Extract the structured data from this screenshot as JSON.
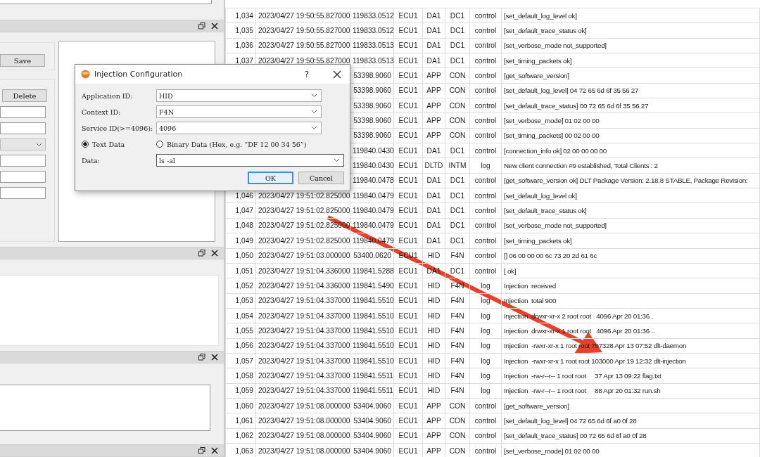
{
  "left_panel": {
    "save_button": "Save",
    "delete_button": "Delete"
  },
  "dialog": {
    "title": "Injection Configuration",
    "help_button": "?",
    "fields": [
      {
        "label": "Application ID:",
        "value": "HID"
      },
      {
        "label": "Context ID:",
        "value": "F4N"
      },
      {
        "label": "Service ID(>=4096):",
        "value": "4096"
      }
    ],
    "radios": [
      {
        "label": "Text Data",
        "selected": true
      },
      {
        "label": "Binary Data (Hex, e.g. “DF 12 00 34 56”)",
        "selected": false
      }
    ],
    "data": {
      "label": "Data:",
      "value": "ls -al"
    },
    "buttons": [
      {
        "label": "OK",
        "default": true
      },
      {
        "label": "Cancel",
        "default": false
      }
    ]
  },
  "log_table": {
    "rows": [
      {
        "index": "1,034",
        "time": "2023/04/27 19:50:55.827000",
        "timestamp": "119833.0512",
        "ecu": "ECU1",
        "apid": "DA1",
        "ctid": "DC1",
        "type": "control",
        "payload": "[set_default_log_level ok]"
      },
      {
        "index": "1,035",
        "time": "2023/04/27 19:50:55.827000",
        "timestamp": "119833.0512",
        "ecu": "ECU1",
        "apid": "DA1",
        "ctid": "DC1",
        "type": "control",
        "payload": "[set_default_trace_status ok]"
      },
      {
        "index": "1,036",
        "time": "2023/04/27 19:50:55.827000",
        "timestamp": "119833.0513",
        "ecu": "ECU1",
        "apid": "DA1",
        "ctid": "DC1",
        "type": "control",
        "payload": "[set_verbose_mode not_supported]"
      },
      {
        "index": "1,037",
        "time": "2023/04/27 19:50:55.827000",
        "timestamp": "119833.0513",
        "ecu": "ECU1",
        "apid": "DA1",
        "ctid": "DC1",
        "type": "control",
        "payload": "[set_timing_packets ok]"
      },
      {
        "timestamp": "53398.9060",
        "ecu": "ECU1",
        "apid": "APP",
        "ctid": "CON",
        "type": "control",
        "payload": "[get_software_version]"
      },
      {
        "timestamp": "53398.9060",
        "ecu": "ECU1",
        "apid": "APP",
        "ctid": "CON",
        "type": "control",
        "payload": "[set_default_log_level] 04 72 65 6d 6f 35 56 27"
      },
      {
        "timestamp": "53398.9060",
        "ecu": "ECU1",
        "apid": "APP",
        "ctid": "CON",
        "type": "control",
        "payload": "[set_default_trace_status] 00 72 65 6d 6f 35 56 27"
      },
      {
        "timestamp": "53398.9060",
        "ecu": "ECU1",
        "apid": "APP",
        "ctid": "CON",
        "type": "control",
        "payload": "[set_verbose_mode] 01 02 00 00"
      },
      {
        "timestamp": "53398.9060",
        "ecu": "ECU1",
        "apid": "APP",
        "ctid": "CON",
        "type": "control",
        "payload": "[set_timing_packets] 00 02 00 00"
      },
      {
        "timestamp": "119840.0430",
        "ecu": "ECU1",
        "apid": "DA1",
        "ctid": "DC1",
        "type": "control",
        "payload": "[connection_info ok] 02 00 00 00 00"
      },
      {
        "timestamp": "119840.0430",
        "ecu": "ECU1",
        "apid": "DLTD",
        "ctid": "INTM",
        "type": "log",
        "payload": "New client connection #9 established, Total Clients : 2"
      },
      {
        "timestamp": "119840.0478",
        "ecu": "ECU1",
        "apid": "DA1",
        "ctid": "DC1",
        "type": "control",
        "payload": "[get_software_version ok] DLT Package Version: 2.18.8 STABLE, Package Revision:"
      },
      {
        "index": "1,046",
        "time": "2023/04/27 19:51:02.825000",
        "timestamp": "119840.0479",
        "ecu": "ECU1",
        "apid": "DA1",
        "ctid": "DC1",
        "type": "control",
        "payload": "[set_default_log_level ok]"
      },
      {
        "index": "1,047",
        "time": "2023/04/27 19:51:02.825000",
        "timestamp": "119840.0479",
        "ecu": "ECU1",
        "apid": "DA1",
        "ctid": "DC1",
        "type": "control",
        "payload": "[set_default_trace_status ok]"
      },
      {
        "index": "1,048",
        "time": "2023/04/27 19:51:02.825000",
        "timestamp": "119840.0479",
        "ecu": "ECU1",
        "apid": "DA1",
        "ctid": "DC1",
        "type": "control",
        "payload": "[set_verbose_mode not_supported]"
      },
      {
        "index": "1,049",
        "time": "2023/04/27 19:51:02.825000",
        "timestamp": "119840.0479",
        "ecu": "ECU1",
        "apid": "DA1",
        "ctid": "DC1",
        "type": "control",
        "payload": "[set_timing_packets ok]"
      },
      {
        "index": "1,050",
        "time": "2023/04/27 19:51:03.000000",
        "timestamp": "53400.0620",
        "ecu": "ECU1",
        "apid": "HID",
        "ctid": "F4N",
        "type": "control",
        "payload": "[] 06 00 00 00 6c 73 20 2d 61 6c"
      },
      {
        "index": "1,051",
        "time": "2023/04/27 19:51:04.336000",
        "timestamp": "119841.5288",
        "ecu": "ECU1",
        "apid": "DA1",
        "ctid": "DC1",
        "type": "control",
        "payload": "[ ok]"
      },
      {
        "index": "1,052",
        "time": "2023/04/27 19:51:04.336000",
        "timestamp": "119841.5490",
        "ecu": "ECU1",
        "apid": "HID",
        "ctid": "F4N",
        "type": "log",
        "payload": "Injection  received"
      },
      {
        "index": "1,053",
        "time": "2023/04/27 19:51:04.337000",
        "timestamp": "119841.5510",
        "ecu": "ECU1",
        "apid": "HID",
        "ctid": "F4N",
        "type": "log",
        "payload": "Injection  total 900"
      },
      {
        "index": "1,054",
        "time": "2023/04/27 19:51:04.337000",
        "timestamp": "119841.5510",
        "ecu": "ECU1",
        "apid": "HID",
        "ctid": "F4N",
        "type": "log",
        "payload": "Injection  drwxr-xr-x 2 root root   4096 Apr 20 01:36 ."
      },
      {
        "index": "1,055",
        "time": "2023/04/27 19:51:04.337000",
        "timestamp": "119841.5510",
        "ecu": "ECU1",
        "apid": "HID",
        "ctid": "F4N",
        "type": "log",
        "payload": "Injection  drwxr-xr-x 1 root root   4096 Apr 20 01:36 .."
      },
      {
        "index": "1,056",
        "time": "2023/04/27 19:51:04.337000",
        "timestamp": "119841.5510",
        "ecu": "ECU1",
        "apid": "HID",
        "ctid": "F4N",
        "type": "log",
        "payload": "Injection  -rwxr-xr-x 1 root root 797328 Apr 13 07:52 dlt-daemon"
      },
      {
        "index": "1,057",
        "time": "2023/04/27 19:51:04.337000",
        "timestamp": "119841.5510",
        "ecu": "ECU1",
        "apid": "HID",
        "ctid": "F4N",
        "type": "log",
        "payload": "Injection  -rwxr-xr-x 1 root root 103000 Apr 19 12:32 dlt-injection"
      },
      {
        "index": "1,058",
        "time": "2023/04/27 19:51:04.337000",
        "timestamp": "119841.5511",
        "ecu": "ECU1",
        "apid": "HID",
        "ctid": "F4N",
        "type": "log",
        "payload": "Injection  -rw-r--r-- 1 root root     37 Apr 13 09:22 flag.txt"
      },
      {
        "index": "1,059",
        "time": "2023/04/27 19:51:04.337000",
        "timestamp": "119841.5511",
        "ecu": "ECU1",
        "apid": "HID",
        "ctid": "F4N",
        "type": "log",
        "payload": "Injection  -rw-r--r-- 1 root root     88 Apr 20 01:32 run.sh"
      },
      {
        "index": "1,060",
        "time": "2023/04/27 19:51:08.000000",
        "timestamp": "53404.9060",
        "ecu": "ECU1",
        "apid": "APP",
        "ctid": "CON",
        "type": "control",
        "payload": "[get_software_version]"
      },
      {
        "index": "1,061",
        "time": "2023/04/27 19:51:08.000000",
        "timestamp": "53404.9060",
        "ecu": "ECU1",
        "apid": "APP",
        "ctid": "CON",
        "type": "control",
        "payload": "[set_default_log_level] 04 72 65 6d 6f a0 0f 28"
      },
      {
        "index": "1,062",
        "time": "2023/04/27 19:51:08.000000",
        "timestamp": "53404.9060",
        "ecu": "ECU1",
        "apid": "APP",
        "ctid": "CON",
        "type": "control",
        "payload": "[set_default_trace_status] 00 72 65 6d 6f a0 0f 28"
      },
      {
        "index": "1,063",
        "time": "2023/04/27 19:51:08.000000",
        "timestamp": "53404.9060",
        "ecu": "ECU1",
        "apid": "APP",
        "ctid": "CON",
        "type": "control",
        "payload": "[set_verbose_mode] 01 02 00 00"
      }
    ]
  }
}
